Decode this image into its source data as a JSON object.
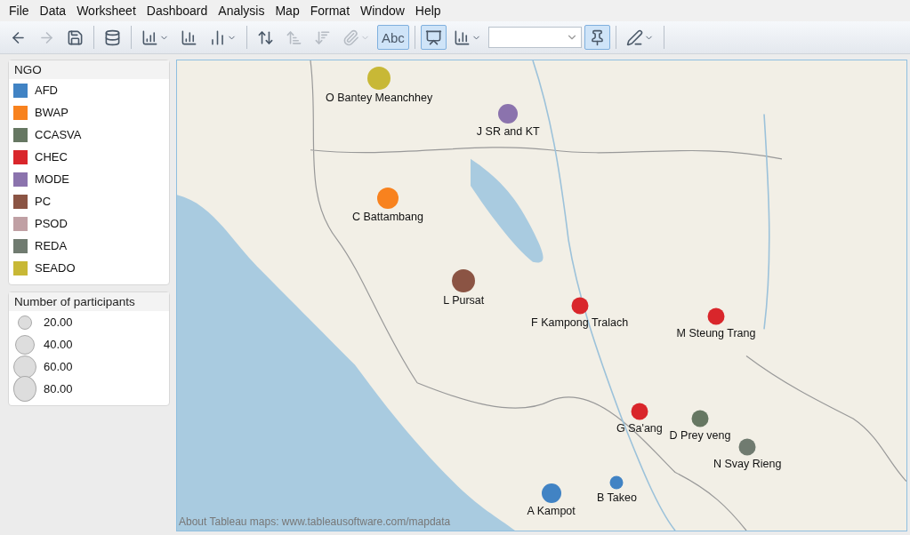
{
  "menu": [
    "File",
    "Data",
    "Worksheet",
    "Dashboard",
    "Analysis",
    "Map",
    "Format",
    "Window",
    "Help"
  ],
  "toolbar": {
    "buttons": [
      {
        "kind": "back",
        "disabled": false,
        "selected": false
      },
      {
        "kind": "forward",
        "disabled": true,
        "selected": false
      },
      {
        "kind": "save",
        "disabled": false,
        "selected": false
      },
      {
        "kind": "separator"
      },
      {
        "kind": "datasource",
        "disabled": false,
        "selected": false
      },
      {
        "kind": "separator"
      },
      {
        "kind": "new-sheet",
        "disabled": false,
        "selected": false,
        "menu": true
      },
      {
        "kind": "duplicate",
        "disabled": false,
        "selected": false
      },
      {
        "kind": "clear",
        "disabled": false,
        "selected": false,
        "menu": true
      },
      {
        "kind": "separator"
      },
      {
        "kind": "swap",
        "disabled": false,
        "selected": false
      },
      {
        "kind": "sort-asc",
        "disabled": true,
        "selected": false
      },
      {
        "kind": "sort-desc",
        "disabled": true,
        "selected": false
      },
      {
        "kind": "attach",
        "disabled": true,
        "selected": false,
        "menu": true
      },
      {
        "kind": "labels",
        "label": "Abc",
        "disabled": false,
        "selected": true
      },
      {
        "kind": "separator"
      },
      {
        "kind": "presentation",
        "disabled": false,
        "selected": true
      },
      {
        "kind": "show-me",
        "disabled": false,
        "selected": false,
        "menu": true
      },
      {
        "kind": "fit-field"
      },
      {
        "kind": "pin",
        "disabled": false,
        "selected": true
      },
      {
        "kind": "separator"
      },
      {
        "kind": "highlight",
        "disabled": false,
        "selected": false,
        "menu": true
      },
      {
        "kind": "separator"
      }
    ]
  },
  "color_legend": {
    "title": "NGO",
    "items": [
      {
        "label": "AFD",
        "color": "#4183c4"
      },
      {
        "label": "BWAP",
        "color": "#f8821e"
      },
      {
        "label": "CCASVA",
        "color": "#667762"
      },
      {
        "label": "CHEC",
        "color": "#d9262b"
      },
      {
        "label": "MODE",
        "color": "#8b73ad"
      },
      {
        "label": "PC",
        "color": "#8b5444"
      },
      {
        "label": "PSOD",
        "color": "#c0a0a4"
      },
      {
        "label": "REDA",
        "color": "#707b70"
      },
      {
        "label": "SEADO",
        "color": "#c8b836"
      }
    ]
  },
  "size_legend": {
    "title": "Number of participants",
    "items": [
      {
        "label": "20.00",
        "kind": "small"
      },
      {
        "label": "40.00",
        "kind": "medium"
      },
      {
        "label": "60.00",
        "kind": "large"
      },
      {
        "label": "80.00",
        "kind": "xlarge"
      }
    ]
  },
  "map": {
    "points": [
      {
        "label": "O Bantey Meanchhey",
        "color": "#c8b836",
        "kind": "xlarge"
      },
      {
        "label": "J SR and KT",
        "color": "#8b73ad",
        "kind": "medium"
      },
      {
        "label": "C Battambang",
        "color": "#f8821e",
        "kind": "large"
      },
      {
        "label": "L Pursat",
        "color": "#8b5444",
        "kind": "xlarge"
      },
      {
        "label": "F Kampong Tralach",
        "color": "#d9262b",
        "kind": "small"
      },
      {
        "label": "M Steung Trang",
        "color": "#d9262b",
        "kind": "small"
      },
      {
        "label": "G Sa'ang",
        "color": "#d9262b",
        "kind": "small"
      },
      {
        "label": "D Prey veng",
        "color": "#667762",
        "kind": "small"
      },
      {
        "label": "N Svay Rieng",
        "color": "#707b70",
        "kind": "small"
      },
      {
        "label": "A Kampot",
        "color": "#4183c4",
        "kind": "medium"
      },
      {
        "label": "B Takeo",
        "color": "#4183c4",
        "kind": "xsmall"
      }
    ],
    "attribution": "About Tableau maps: www.tableausoftware.com/mapdata"
  }
}
